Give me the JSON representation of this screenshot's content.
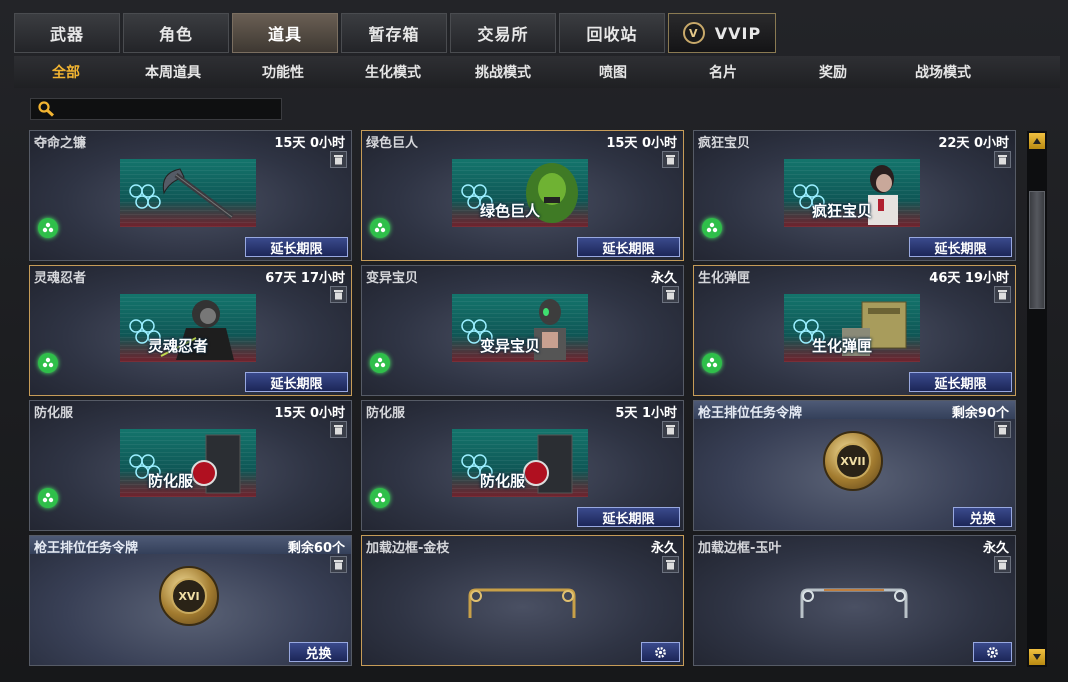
{
  "tabs": [
    {
      "label": "武器"
    },
    {
      "label": "角色"
    },
    {
      "label": "道具",
      "active": true
    },
    {
      "label": "暂存箱"
    },
    {
      "label": "交易所"
    },
    {
      "label": "回收站"
    },
    {
      "label": "VVIP"
    }
  ],
  "subtabs": [
    {
      "label": "全部",
      "active": true
    },
    {
      "label": "本周道具"
    },
    {
      "label": "功能性"
    },
    {
      "label": "生化模式"
    },
    {
      "label": "挑战模式"
    },
    {
      "label": "喷图"
    },
    {
      "label": "名片"
    },
    {
      "label": "奖励"
    },
    {
      "label": "战场模式"
    }
  ],
  "search": {
    "placeholder": ""
  },
  "items": [
    {
      "name": "夺命之镰",
      "time": "15天 0小时",
      "thumb_label": "",
      "button": "延长期限",
      "style": "normal"
    },
    {
      "name": "绿色巨人",
      "time": "15天 0小时",
      "thumb_label": "绿色巨人",
      "button": "延长期限",
      "style": "gold"
    },
    {
      "name": "疯狂宝贝",
      "time": "22天 0小时",
      "thumb_label": "疯狂宝贝",
      "button": "延长期限",
      "style": "normal"
    },
    {
      "name": "灵魂忍者",
      "time": "67天 17小时",
      "thumb_label": "灵魂忍者",
      "button": "延长期限",
      "style": "gold"
    },
    {
      "name": "变异宝贝",
      "time": "永久",
      "thumb_label": "变异宝贝",
      "button": "",
      "style": "normal"
    },
    {
      "name": "生化弹匣",
      "time": "46天 19小时",
      "thumb_label": "生化弹匣",
      "button": "延长期限",
      "style": "gold"
    },
    {
      "name": "防化服",
      "time": "15天 0小时",
      "thumb_label": "防化服",
      "button": "",
      "style": "normal"
    },
    {
      "name": "防化服",
      "time": "5天 1小时",
      "thumb_label": "防化服",
      "button": "延长期限",
      "style": "normal"
    },
    {
      "name": "枪王排位任务令牌",
      "time": "剩余90个",
      "badge": "XVII",
      "button": "兑换",
      "style": "token"
    },
    {
      "name": "枪王排位任务令牌",
      "time": "剩余60个",
      "badge": "XVI",
      "button": "兑换",
      "style": "token"
    },
    {
      "name": "加载边框-金枝",
      "time": "永久",
      "button": "",
      "style": "frame-gold"
    },
    {
      "name": "加载边框-玉叶",
      "time": "永久",
      "button": "",
      "style": "frame-jade"
    }
  ],
  "colors": {
    "accent": "#f2b431",
    "button": "#2a3676",
    "gold_border": "#c69c58"
  }
}
